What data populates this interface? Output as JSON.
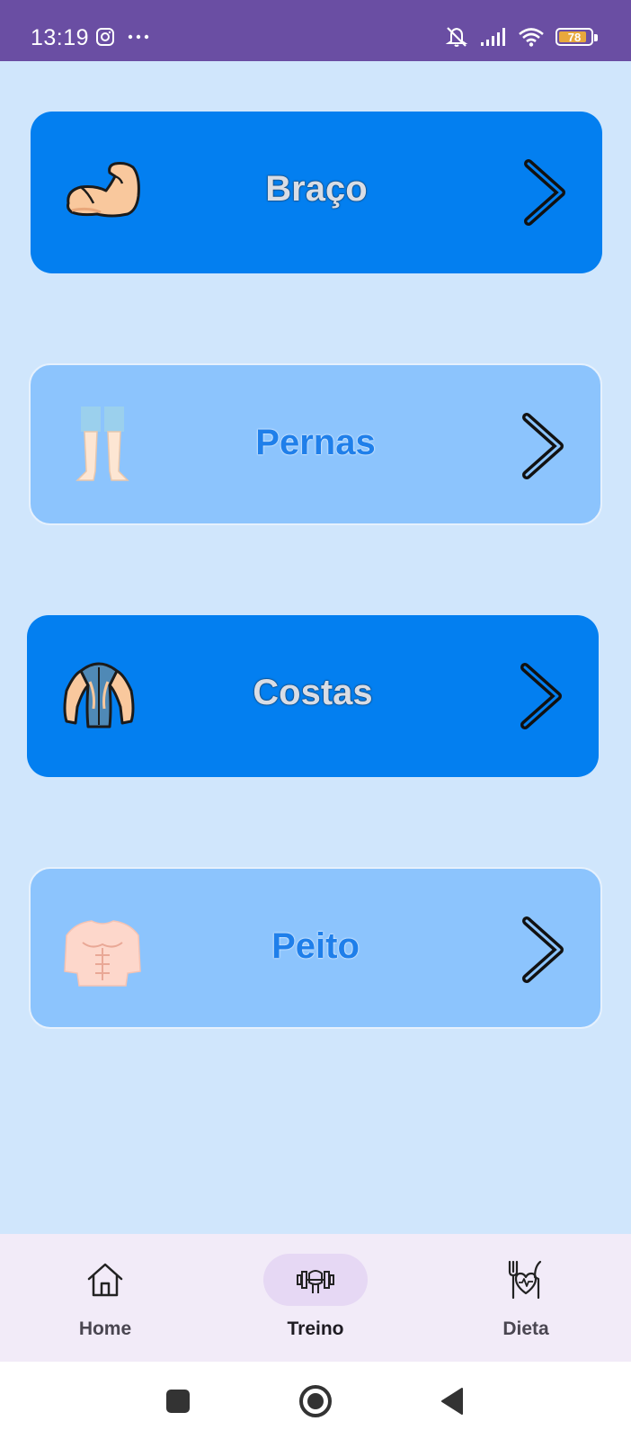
{
  "status_bar": {
    "time": "13:19",
    "battery": "78",
    "icons": [
      "instagram-icon",
      "more-dots-icon",
      "mute-icon",
      "signal-icon",
      "wifi-icon",
      "battery-icon"
    ]
  },
  "cards": [
    {
      "label": "Braço",
      "icon": "flexed-arm-icon",
      "style": "dark"
    },
    {
      "label": "Pernas",
      "icon": "legs-icon",
      "style": "light"
    },
    {
      "label": "Costas",
      "icon": "back-muscles-icon",
      "style": "dark"
    },
    {
      "label": "Peito",
      "icon": "chest-icon",
      "style": "light"
    }
  ],
  "bottom_nav": {
    "items": [
      {
        "label": "Home",
        "icon": "home-icon",
        "active": false
      },
      {
        "label": "Treino",
        "icon": "dumbbell-icon",
        "active": true
      },
      {
        "label": "Dieta",
        "icon": "diet-heart-icon",
        "active": false
      }
    ]
  },
  "colors": {
    "status_bar": "#6a4ea3",
    "background": "#d0e6fc",
    "card_dark": "#037ff0",
    "card_light": "#8cc4fd",
    "nav_background": "#f2ebf8",
    "nav_active_pill": "#e6d8f4"
  }
}
